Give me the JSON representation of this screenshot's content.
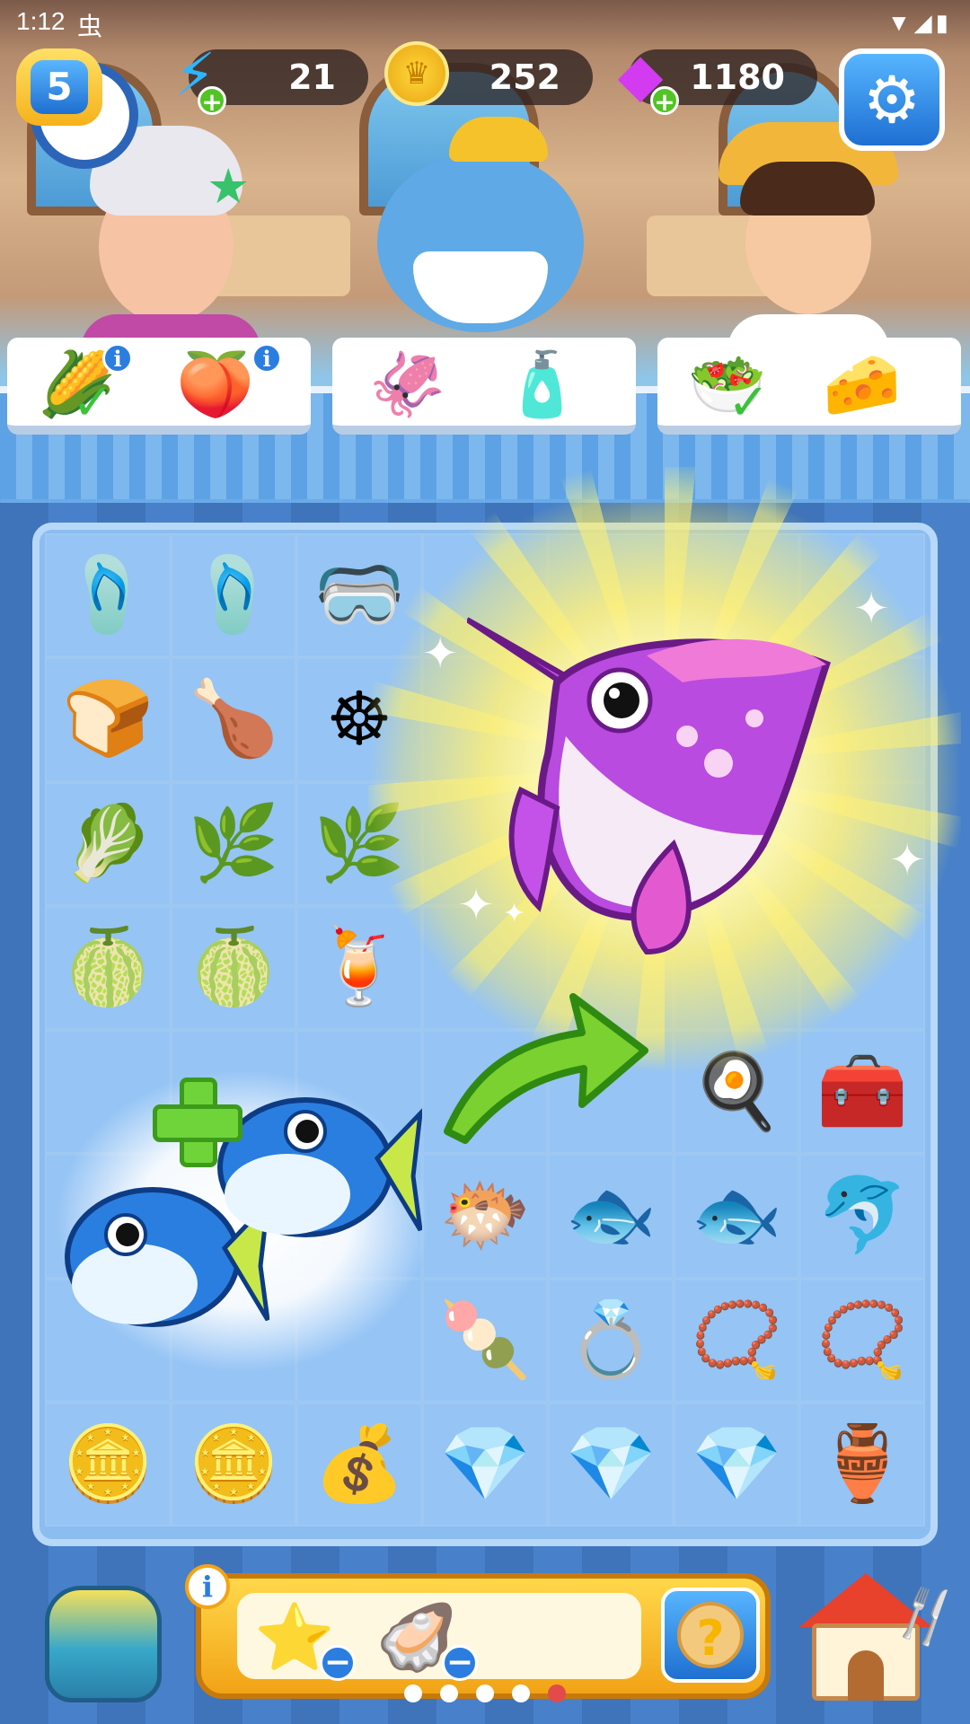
{
  "status_bar": {
    "time": "1:12",
    "notification_glyph": "虫",
    "icons": "▼◢▮"
  },
  "hud": {
    "level": "5",
    "energy": "21",
    "coins": "252",
    "gems": "1180",
    "plus": "+"
  },
  "customers": [
    {
      "name_icon": "grandma-customer",
      "order": [
        "🌽",
        "🍑"
      ],
      "order_icons": [
        "corn-icon",
        "peach-icon"
      ],
      "fulfilled": [
        true,
        false
      ]
    },
    {
      "name_icon": "hippo-customer",
      "order": [
        "🦑",
        "🧴"
      ],
      "order_icons": [
        "squid-icon",
        "bottle-icon"
      ],
      "fulfilled": [
        false,
        false
      ]
    },
    {
      "name_icon": "boy-customer",
      "order": [
        "🥗",
        "🧀"
      ],
      "order_icons": [
        "salad-plate-icon",
        "cheese-icon"
      ],
      "fulfilled": [
        true,
        false
      ]
    }
  ],
  "order_info": "i",
  "check": "✓",
  "board": {
    "rows": [
      [
        "🩴",
        "🩴",
        "🥽",
        "",
        "",
        "",
        ""
      ],
      [
        "🍞",
        "🍗",
        "☸",
        "",
        "",
        "",
        ""
      ],
      [
        "🥬",
        "🌿",
        "🌿",
        "",
        "",
        "",
        ""
      ],
      [
        "🍈",
        "🍈",
        "🍹",
        "",
        "",
        "",
        ""
      ],
      [
        "",
        "",
        "",
        "",
        "",
        "🍳",
        "🧰"
      ],
      [
        "",
        "",
        "",
        "🐡",
        "🐟",
        "🐟",
        "🐬"
      ],
      [
        "",
        "",
        "",
        "🍡",
        "💍",
        "📿",
        "📿"
      ],
      [
        "🪙",
        "🪙",
        "💰",
        "💎",
        "💎",
        "💎",
        "🏺"
      ]
    ]
  },
  "merge_preview": {
    "result": "swordfish",
    "source": "tuna"
  },
  "bottom": {
    "info": "i",
    "tray_items": [
      "⭐",
      "🦪"
    ],
    "tray_item_icons": [
      "starfish-icon",
      "mussel-icon"
    ],
    "minus": "−",
    "mystery": "?",
    "page_count": 5,
    "active_page": 5
  },
  "colors": {
    "accent": "#2c7de0",
    "gold": "#f2a316",
    "gem": "#d33bf0",
    "board": "#8cbdf0"
  }
}
